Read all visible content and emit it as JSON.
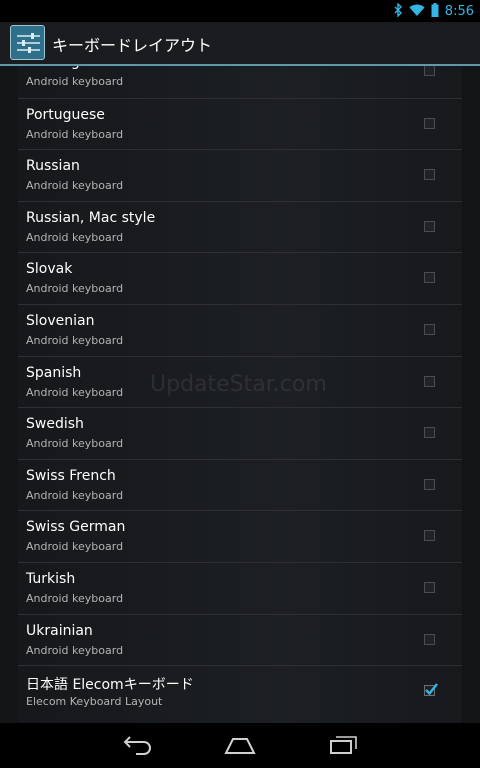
{
  "status_bar": {
    "time": "8:56",
    "icons": [
      "bluetooth-icon",
      "wifi-icon",
      "battery-icon"
    ],
    "accent_color": "#33b5e5"
  },
  "action_bar": {
    "title": "キーボードレイアウト",
    "icon": "settings-sliders-icon"
  },
  "list": {
    "items": [
      {
        "title": "Norwegian",
        "subtitle": "Android keyboard",
        "checked": false
      },
      {
        "title": "Portuguese",
        "subtitle": "Android keyboard",
        "checked": false
      },
      {
        "title": "Russian",
        "subtitle": "Android keyboard",
        "checked": false
      },
      {
        "title": "Russian, Mac style",
        "subtitle": "Android keyboard",
        "checked": false
      },
      {
        "title": "Slovak",
        "subtitle": "Android keyboard",
        "checked": false
      },
      {
        "title": "Slovenian",
        "subtitle": "Android keyboard",
        "checked": false
      },
      {
        "title": "Spanish",
        "subtitle": "Android keyboard",
        "checked": false
      },
      {
        "title": "Swedish",
        "subtitle": "Android keyboard",
        "checked": false
      },
      {
        "title": "Swiss French",
        "subtitle": "Android keyboard",
        "checked": false
      },
      {
        "title": "Swiss German",
        "subtitle": "Android keyboard",
        "checked": false
      },
      {
        "title": "Turkish",
        "subtitle": "Android keyboard",
        "checked": false
      },
      {
        "title": "Ukrainian",
        "subtitle": "Android keyboard",
        "checked": false
      },
      {
        "title": "日本語 Elecomキーボード",
        "subtitle": "Elecom Keyboard Layout",
        "checked": true
      }
    ]
  },
  "watermark": "UpdateStar.com",
  "nav_bar": {
    "buttons": [
      "back-icon",
      "home-icon",
      "recent-apps-icon"
    ]
  }
}
